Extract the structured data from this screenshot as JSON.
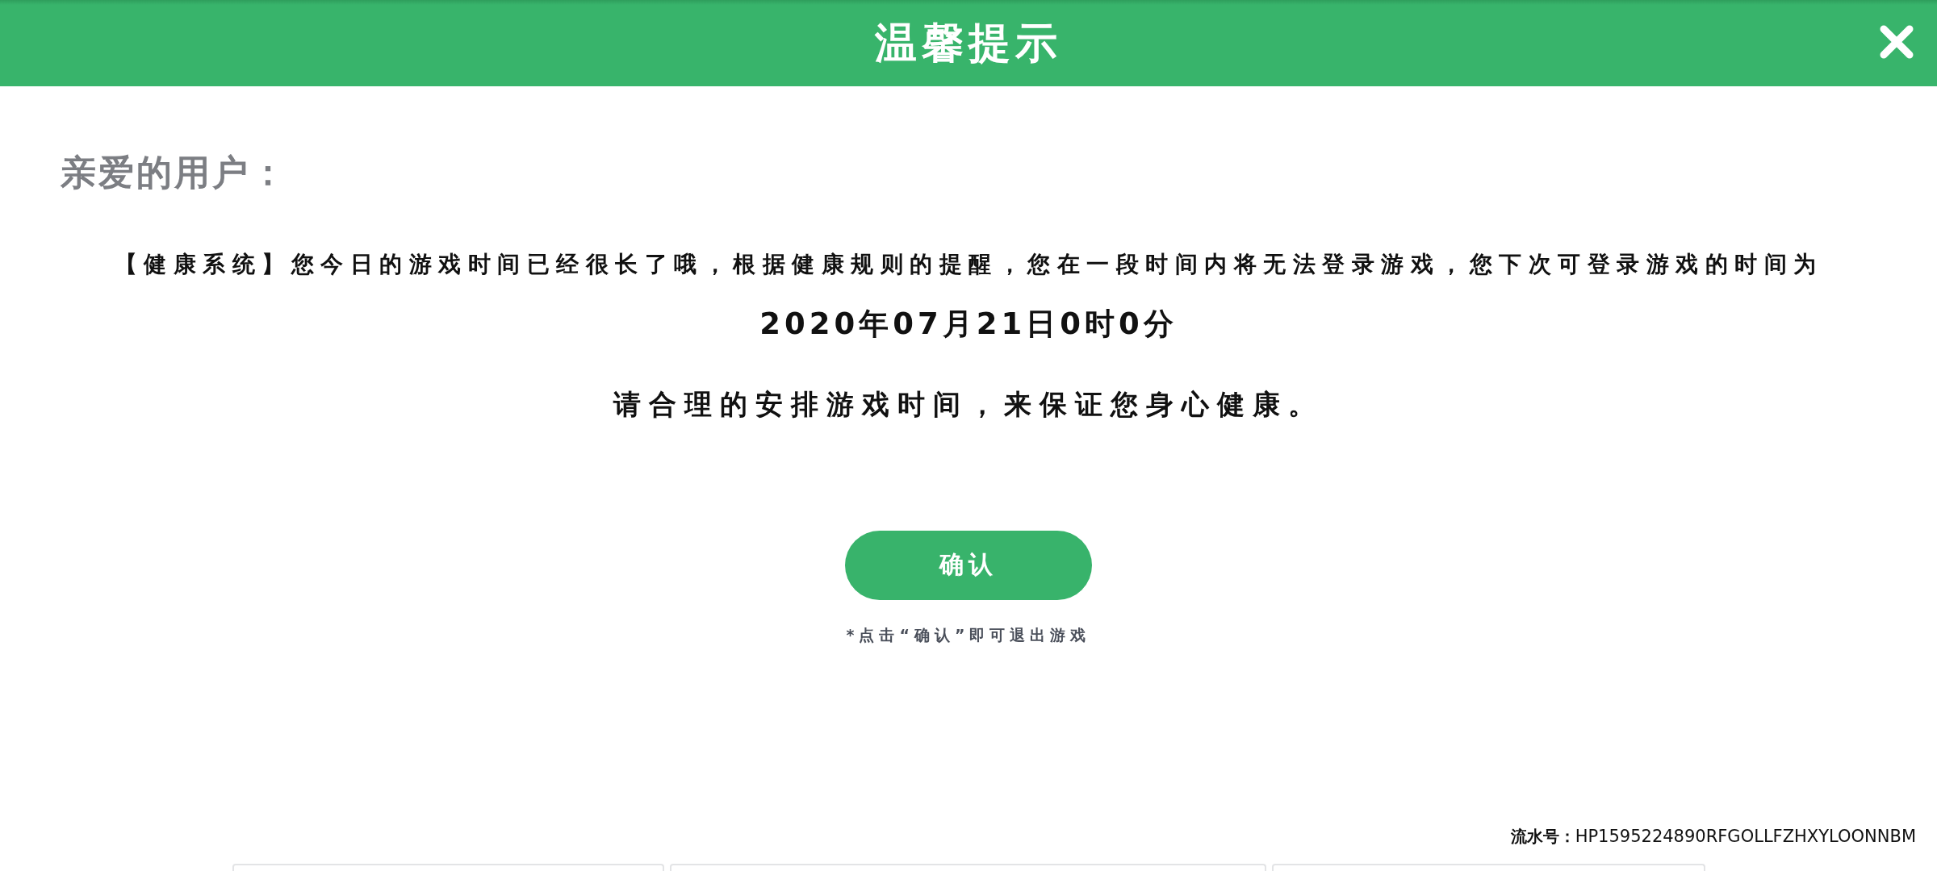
{
  "header": {
    "title": "温馨提示"
  },
  "greeting": "亲爱的用户：",
  "message": {
    "text": "【健康系统】您今日的游戏时间已经很长了哦，根据健康规则的提醒，您在一段时间内将无法登录游戏，您下次可登录游戏的时间为",
    "next_login_time": "2020年07月21日0时0分",
    "advice": "请合理的安排游戏时间，来保证您身心健康。"
  },
  "confirm": {
    "label": "确认",
    "note": "*点击“确认”即可退出游戏"
  },
  "serial": {
    "label": "流水号：",
    "value": "HP1595224890RFGOLLFZHXYLOONNBM"
  }
}
